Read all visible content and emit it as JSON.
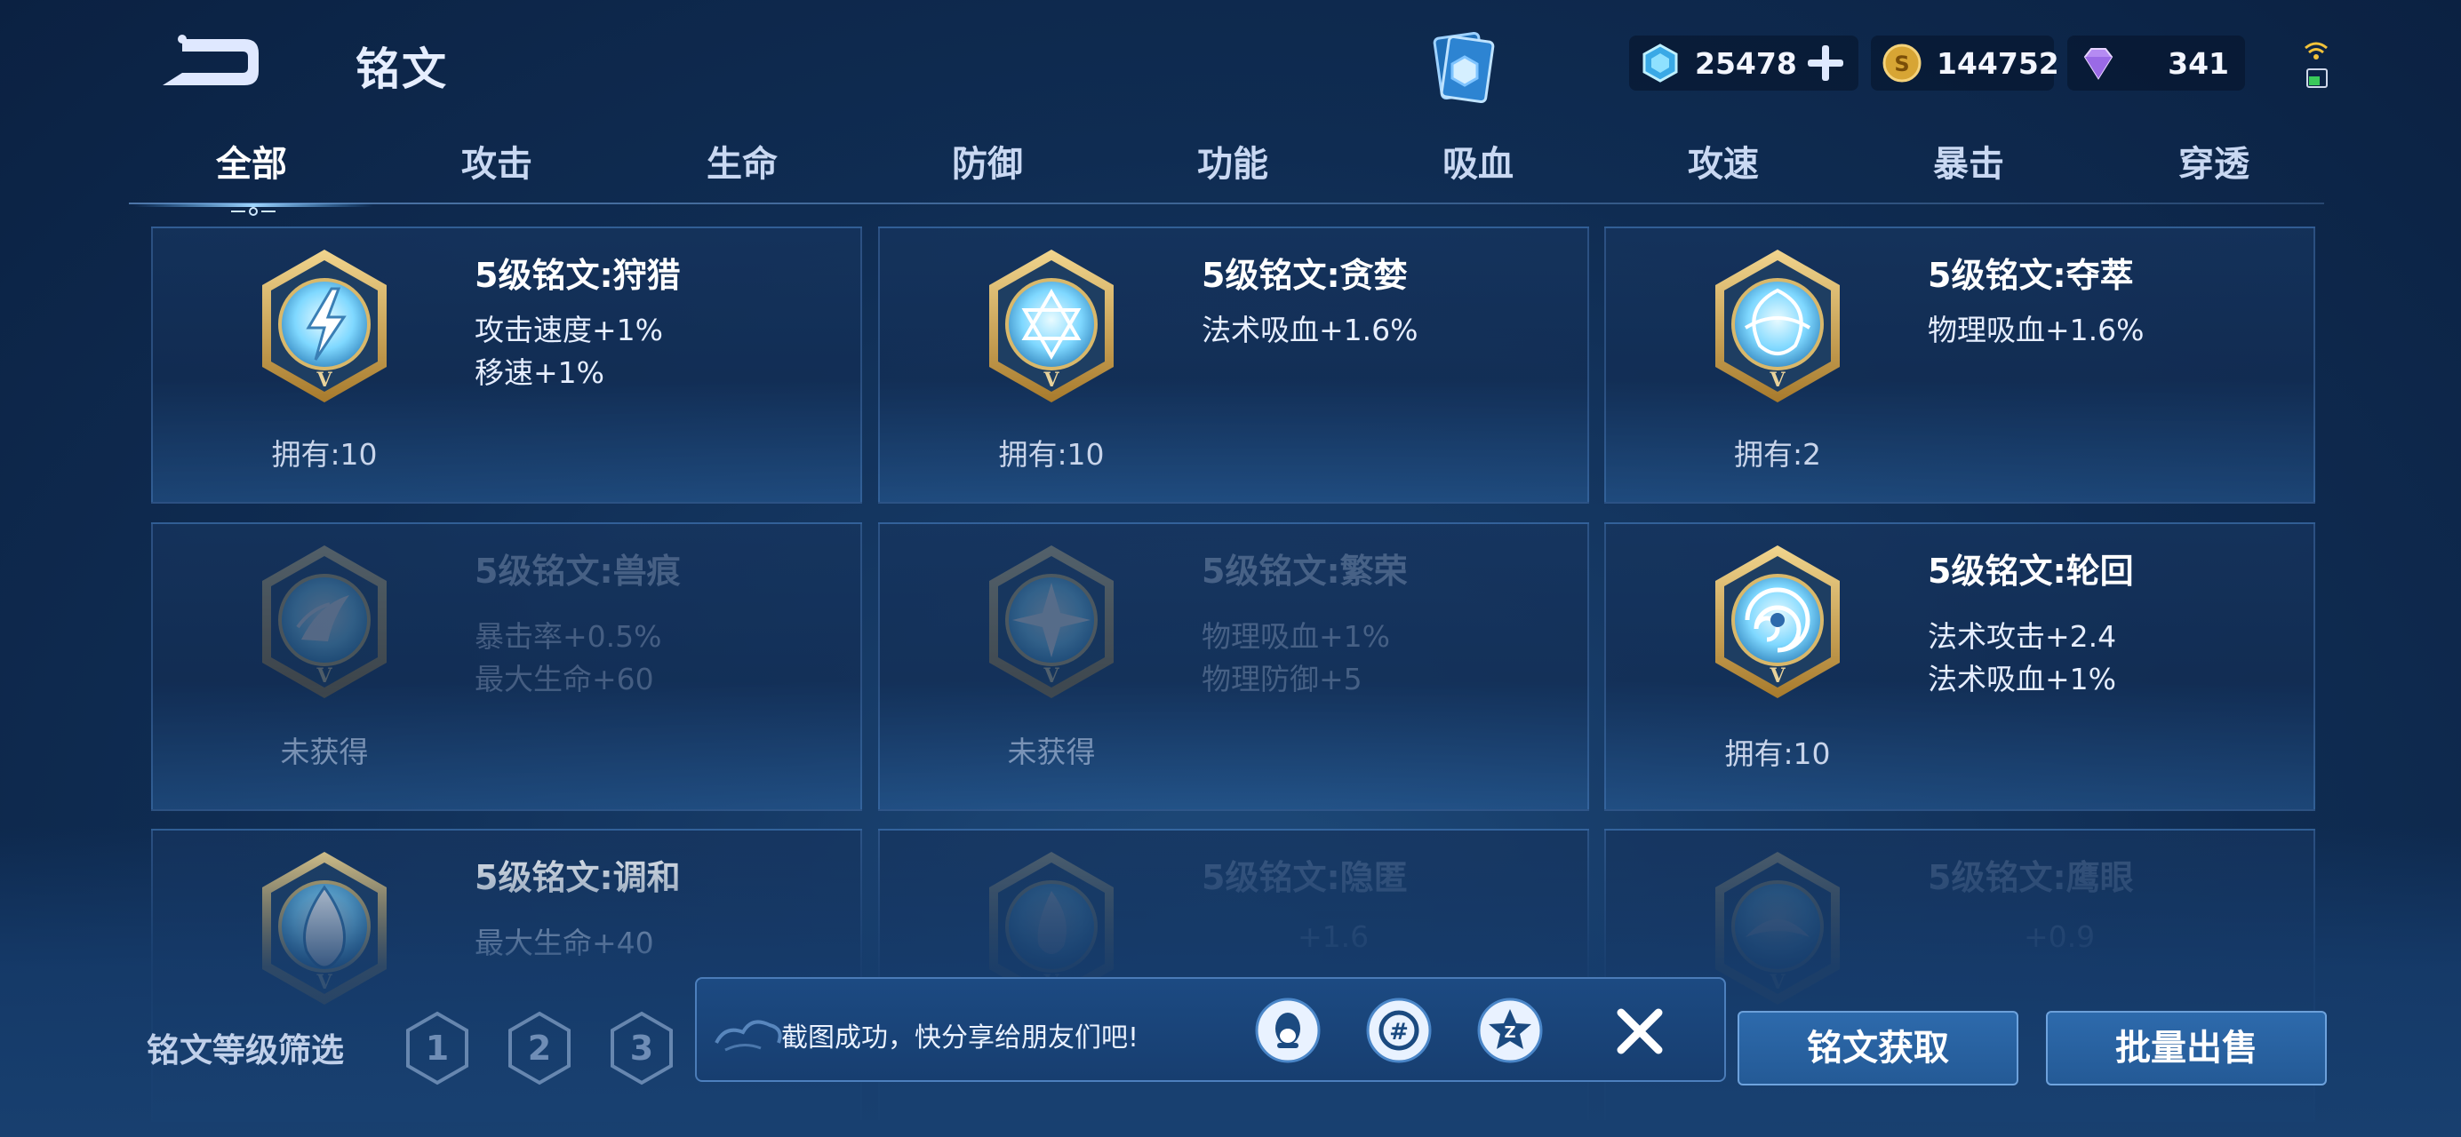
{
  "header": {
    "title": "铭文",
    "currencies": {
      "crystal": "25478",
      "gold": "144752",
      "diamond": "341"
    }
  },
  "tabs": [
    "全部",
    "攻击",
    "生命",
    "防御",
    "功能",
    "吸血",
    "攻速",
    "暴击",
    "穿透"
  ],
  "active_tab": "全部",
  "cards": [
    {
      "name": "5级铭文:狩猎",
      "stats": [
        "攻击速度+1%",
        "移速+1%"
      ],
      "owned": "拥有:10",
      "emblem": "lightning-emblem-icon"
    },
    {
      "name": "5级铭文:贪婪",
      "stats": [
        "法术吸血+1.6%"
      ],
      "owned": "拥有:10",
      "emblem": "star-of-david-emblem-icon"
    },
    {
      "name": "5级铭文:夺萃",
      "stats": [
        "物理吸血+1.6%"
      ],
      "owned": "拥有:2",
      "emblem": "knot-emblem-icon"
    },
    {
      "name": "5级铭文:兽痕",
      "stats": [
        "暴击率+0.5%",
        "最大生命+60"
      ],
      "owned": "未获得",
      "emblem": "claw-emblem-icon"
    },
    {
      "name": "5级铭文:繁荣",
      "stats": [
        "物理吸血+1%",
        "物理防御+5"
      ],
      "owned": "未获得",
      "emblem": "cross-star-emblem-icon"
    },
    {
      "name": "5级铭文:轮回",
      "stats": [
        "法术攻击+2.4",
        "法术吸血+1%"
      ],
      "owned": "拥有:10",
      "emblem": "swirl-emblem-icon"
    },
    {
      "name": "5级铭文:调和",
      "stats": [
        "最大生命+40"
      ],
      "owned": "",
      "emblem": "drop-emblem-icon"
    },
    {
      "name": "5级铭文:隐匿",
      "stats": [
        "+1.6"
      ],
      "owned": "",
      "emblem": "flame-emblem-icon"
    },
    {
      "name": "5级铭文:鹰眼",
      "stats": [
        "+0.9"
      ],
      "owned": "",
      "emblem": "hawk-emblem-icon"
    }
  ],
  "filter": {
    "label": "铭文等级筛选",
    "levels": [
      "1",
      "2",
      "3"
    ]
  },
  "toast": {
    "message": "截图成功，快分享给朋友们吧!",
    "share_targets": [
      "qq-icon",
      "wechat-moments-icon",
      "qzone-icon"
    ],
    "close_icon": "close-icon"
  },
  "actions": {
    "get": "铭文获取",
    "sell": "批量出售"
  },
  "colors": {
    "background": "#12325e",
    "accent": "#2d6aac",
    "gold": "#c9a557",
    "gem_cyan": "#7fd8ff"
  }
}
